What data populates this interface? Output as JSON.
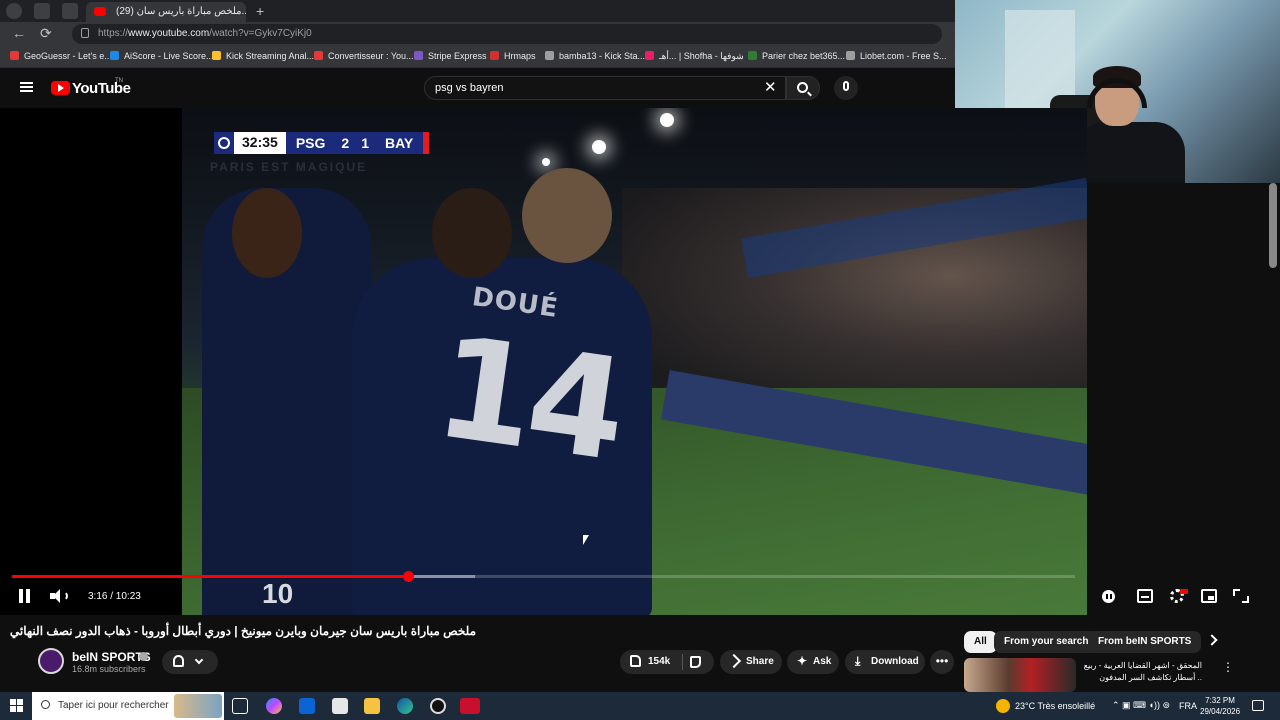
{
  "browser": {
    "tab_title": "(29) ملخص مباراة باريس سان...",
    "url_scheme": "https://",
    "url_host": "www.youtube.com",
    "url_path": "/watch?v=Gykv7CyiKj0",
    "bookmarks": [
      {
        "label": "GeoGuessr - Let's e...",
        "color": "#e53935"
      },
      {
        "label": "AiScore - Live Score...",
        "color": "#1e88e5"
      },
      {
        "label": "Kick Streaming Anal...",
        "color": "#fbc02d"
      },
      {
        "label": "Convertisseur : You...",
        "color": "#e53935"
      },
      {
        "label": "Stripe Express",
        "color": "#7e57c2"
      },
      {
        "label": "Hrmaps",
        "color": "#d32f2f"
      },
      {
        "label": "bamba13 - Kick Sta...",
        "color": "#9e9e9e"
      },
      {
        "label": "أهـ... | Shofha - شوفها",
        "color": "#e91e63"
      },
      {
        "label": "Parier chez bet365...",
        "color": "#2e7d32"
      },
      {
        "label": "Liobet.com - Free S...",
        "color": "#9e9e9e"
      }
    ]
  },
  "youtube": {
    "logo_text": "YouTube",
    "logo_region": "TN",
    "search_query": "psg vs bayren"
  },
  "video": {
    "scoreboard": {
      "time": "32:35",
      "home": "PSG",
      "home_score": "2",
      "away_score": "1",
      "away": "BAY"
    },
    "tagline": "PARIS EST MAGIQUE",
    "jersey_name": "DOUÉ",
    "jersey_number": "14",
    "shorts_number": "10",
    "current_time": "3:16",
    "duration": "10:23",
    "time_display": "3:16 / 10:23",
    "progress_fraction": 0.3724,
    "buffer_fraction": 0.436,
    "hd_badge_color": "#ff0000",
    "title": "ملخص مباراة باريس سان جيرمان وبايرن ميونيخ | دوري أبطال أوروبا - ذهاب الدور نصف النهائي",
    "channel": {
      "name": "beIN SPORTS",
      "subscribers": "16.8m subscribers"
    },
    "actions": {
      "likes": "154k",
      "share": "Share",
      "ask": "Ask",
      "download": "Download"
    }
  },
  "sidebar": {
    "chips": [
      "All",
      "From your search",
      "From beIN SPORTS"
    ],
    "related_title": "المحقق - اشهر القضايا العربية - ربيع .. أسطار تكاشف السر المدفون"
  },
  "taskbar": {
    "search_placeholder": "Taper ici pour rechercher",
    "weather": "23°C  Très ensoleillé",
    "language": "FRA",
    "time": "7:32 PM",
    "date": "29/04/2026"
  }
}
